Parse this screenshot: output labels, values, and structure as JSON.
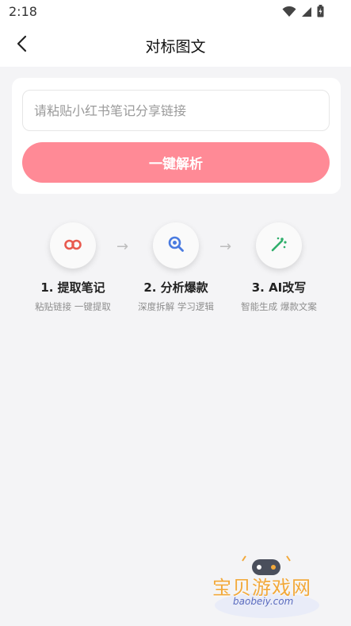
{
  "status_bar": {
    "time": "2:18"
  },
  "header": {
    "title": "对标图文",
    "back_icon": "chevron-left-icon"
  },
  "input": {
    "placeholder": "请粘贴小红书笔记分享链接",
    "value": ""
  },
  "parse_button": {
    "label": "一键解析",
    "color": "#ff8a96"
  },
  "steps": [
    {
      "icon": "link-icon",
      "title": "1. 提取笔记",
      "desc": "粘贴链接 一键提取"
    },
    {
      "icon": "search-analysis-icon",
      "title": "2. 分析爆款",
      "desc": "深度拆解 学习逻辑"
    },
    {
      "icon": "sparkle-icon",
      "title": "3. AI改写",
      "desc": "智能生成 爆款文案"
    }
  ],
  "watermark": {
    "title": "宝贝游戏网",
    "subtitle": "baobeiy.com"
  }
}
